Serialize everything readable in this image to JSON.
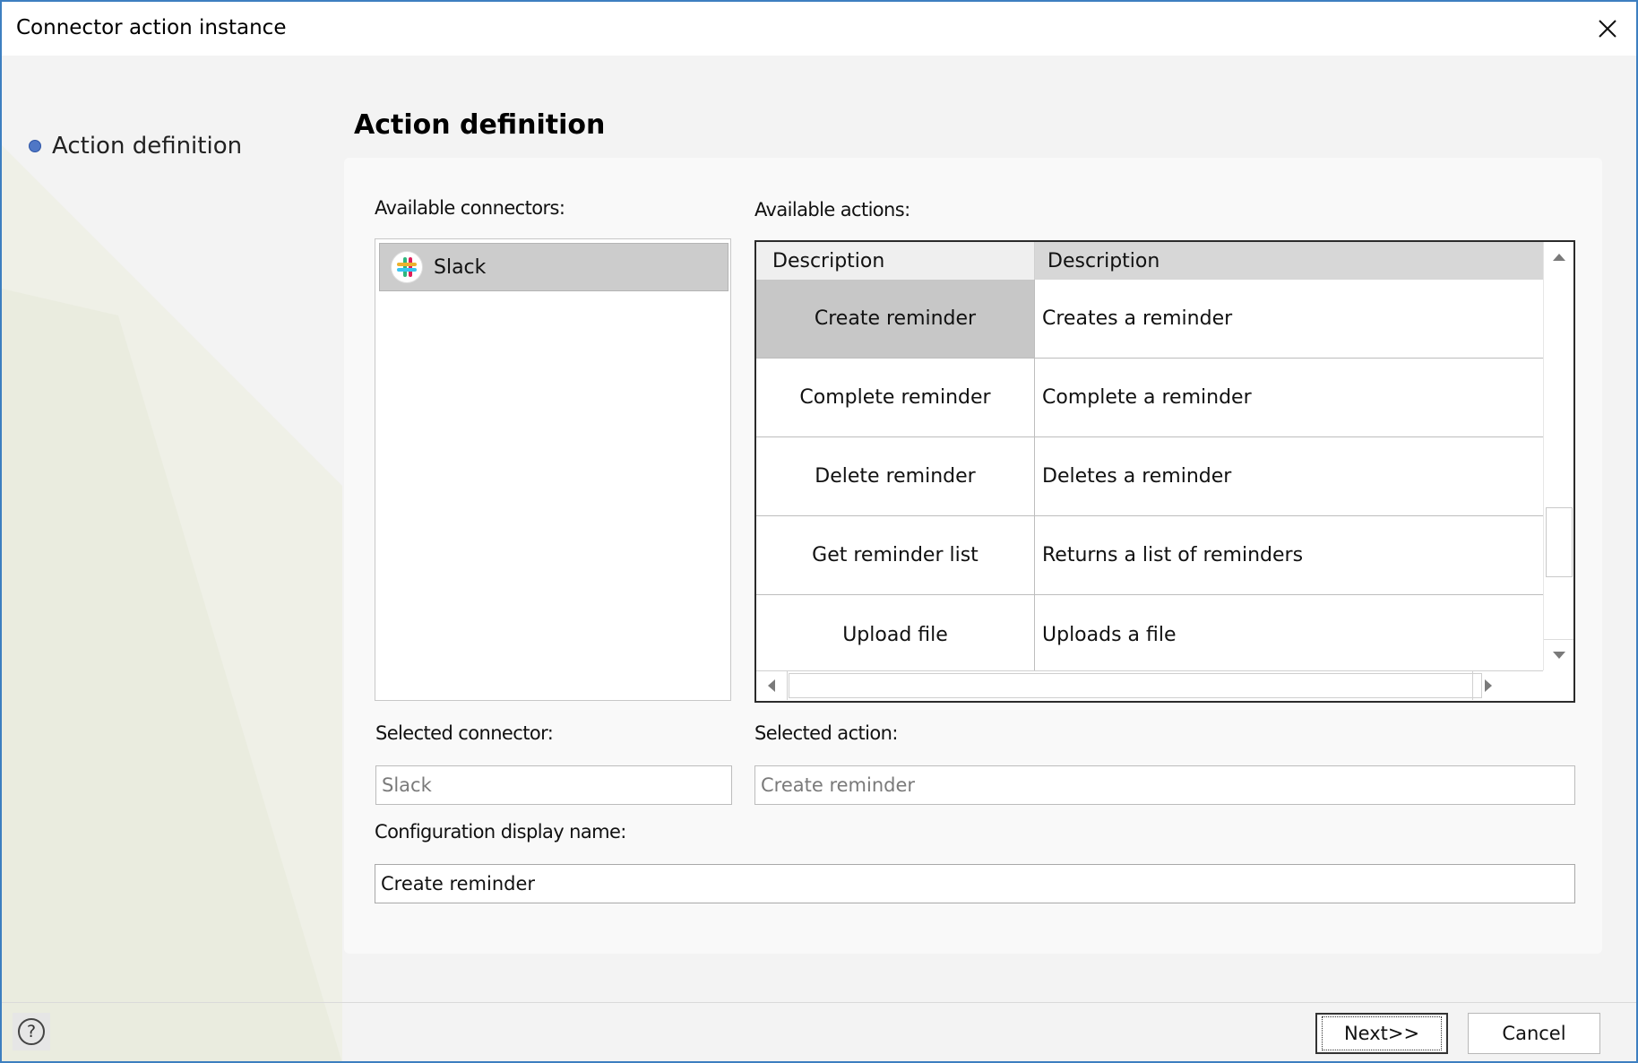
{
  "window": {
    "title": "Connector action instance"
  },
  "nav": {
    "items": [
      {
        "label": "Action definition"
      }
    ]
  },
  "page": {
    "heading": "Action definition"
  },
  "connectors": {
    "label": "Available connectors:",
    "items": [
      {
        "name": "Slack",
        "icon": "slack-icon",
        "selected": true
      }
    ]
  },
  "actions": {
    "label": "Available actions:",
    "columns": [
      "Description",
      "Description"
    ],
    "rows": [
      {
        "name": "Create reminder",
        "description": "Creates a reminder",
        "selected": true
      },
      {
        "name": "Complete reminder",
        "description": "Complete a reminder",
        "selected": false
      },
      {
        "name": "Delete reminder",
        "description": "Deletes a reminder",
        "selected": false
      },
      {
        "name": "Get reminder list",
        "description": "Returns a list of reminders",
        "selected": false
      },
      {
        "name": "Upload file",
        "description": "Uploads a file",
        "selected": false
      }
    ]
  },
  "selected_connector": {
    "label": "Selected connector:",
    "value": "Slack"
  },
  "selected_action": {
    "label": "Selected action:",
    "value": "Create reminder"
  },
  "config_name": {
    "label": "Configuration display name:",
    "value": "Create reminder"
  },
  "footer": {
    "help_symbol": "?",
    "next_label": "Next>>",
    "cancel_label": "Cancel"
  },
  "colors": {
    "window_border": "#3d7fc0",
    "selection_gray": "#cccccc",
    "nav_dot": "#4f77c6"
  }
}
